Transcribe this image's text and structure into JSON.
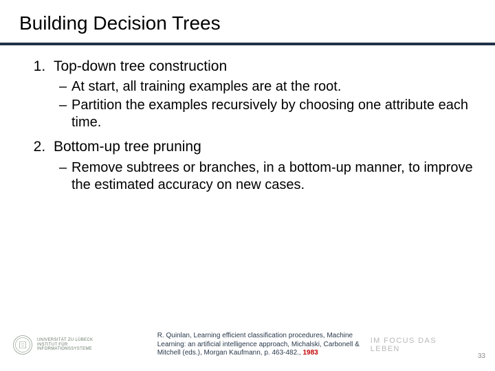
{
  "title": "Building Decision Trees",
  "items": [
    {
      "head": "Top-down tree construction",
      "subs": [
        "At start, all training examples are at the root.",
        "Partition the examples recursively by choosing one attribute each time."
      ]
    },
    {
      "head": "Bottom-up tree pruning",
      "subs": [
        "Remove subtrees or branches, in a bottom-up manner, to improve the estimated accuracy on new cases."
      ]
    }
  ],
  "citation": {
    "text": "R. Quinlan, Learning efficient classification procedures, Machine Learning: an artificial intelligence approach, Michalski, Carbonell & Mitchell (eds.), Morgan Kaufmann, p. 463-482., ",
    "year": "1983"
  },
  "university": {
    "line1": "UNIVERSITÄT ZU LÜBECK",
    "line2": "INSTITUT FÜR INFORMATIONSSYSTEME"
  },
  "tagline": "IM FOCUS DAS LEBEN",
  "page_number": "33"
}
